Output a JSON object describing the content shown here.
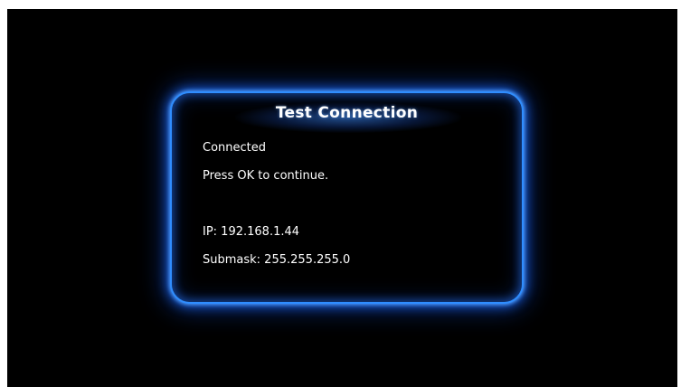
{
  "dialog": {
    "title": "Test Connection",
    "status": "Connected",
    "prompt": "Press OK to continue.",
    "ip": "IP: 192.168.1.44",
    "submask": "Submask: 255.255.255.0"
  },
  "colors": {
    "background": "#000000",
    "accent_glow": "#2f8dff",
    "text": "#ffffff"
  }
}
